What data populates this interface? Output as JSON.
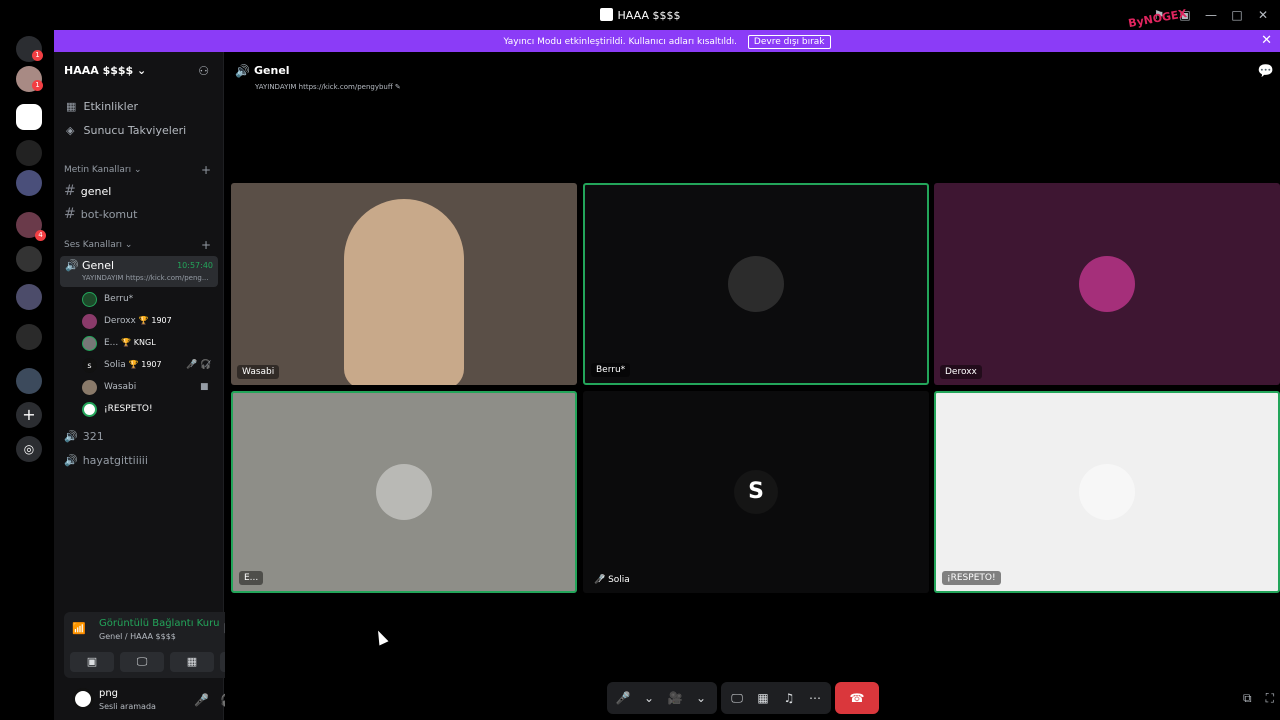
{
  "window": {
    "title": "HAAA $$$$",
    "controls": [
      "⚑",
      "▣",
      "—",
      "□",
      "✕"
    ]
  },
  "banner": {
    "message": "Yayıncı Modu etkinleştirildi. Kullanıcı adları kısaltıldı.",
    "button": "Devre dışı bırak",
    "close": "✕",
    "watermark": "ByNOGEX"
  },
  "server": {
    "name": "HAAA $$$$ ⌄",
    "nav": [
      {
        "icon": "▦",
        "label": "Etkinlikler"
      },
      {
        "icon": "◈",
        "label": "Sunucu Takviyeleri"
      }
    ],
    "text_category": "Metin Kanalları ⌄",
    "text_channels": [
      "genel",
      "bot-komut"
    ],
    "voice_category": "Ses Kanalları ⌄",
    "active_voice": {
      "name": "Genel",
      "time": "10:57:40",
      "status": "YAYINDAYIM https://kick.com/peng..."
    },
    "voice_users": [
      {
        "name": "Berru*",
        "tag": ""
      },
      {
        "name": "Deroxx",
        "tag": "🏆 1907"
      },
      {
        "name": "E...",
        "tag": "🏆 KNGL"
      },
      {
        "name": "Solia",
        "tag": "🏆 1907"
      },
      {
        "name": "Wasabi",
        "tag": ""
      },
      {
        "name": "¡RESPETO!",
        "tag": ""
      }
    ],
    "other_voice": [
      "321",
      "hayatgittiiiii"
    ]
  },
  "voice_panel": {
    "title": "Görüntülü Bağlantı Kuru",
    "subtitle": "Genel / HAAA $$$$"
  },
  "user": {
    "name": "png",
    "status": "Sesli aramada"
  },
  "main": {
    "channel": "Genel",
    "status": "YAYINDAYIM https://kick.com/pengybuff ✎"
  },
  "tiles": [
    {
      "label": "Wasabi",
      "bg": "#5a4f47",
      "avatar": "#c8a98a",
      "speaking": false
    },
    {
      "label": "Berru*",
      "bg": "#0c0c0d",
      "avatar": "#2c2c2c",
      "speaking": true
    },
    {
      "label": "Deroxx",
      "bg": "#3e1632",
      "avatar": "#a52f7a",
      "speaking": false
    },
    {
      "label": "E...",
      "bg": "#8e8e88",
      "avatar": "#b9b9b5",
      "speaking": true
    },
    {
      "label": "🎤̸ Solia",
      "bg": "#0b0b0c",
      "avatar": "#151515",
      "speaking": false
    },
    {
      "label": "¡RESPETO!",
      "bg": "#f0f0f0",
      "avatar": "#f7f7f7",
      "speaking": true
    }
  ],
  "controls": {
    "mic": "🎤",
    "camera": "🎥",
    "share": "🖵",
    "activities": "▦",
    "soundboard": "♫",
    "more": "⋯",
    "hangup": "☎"
  }
}
